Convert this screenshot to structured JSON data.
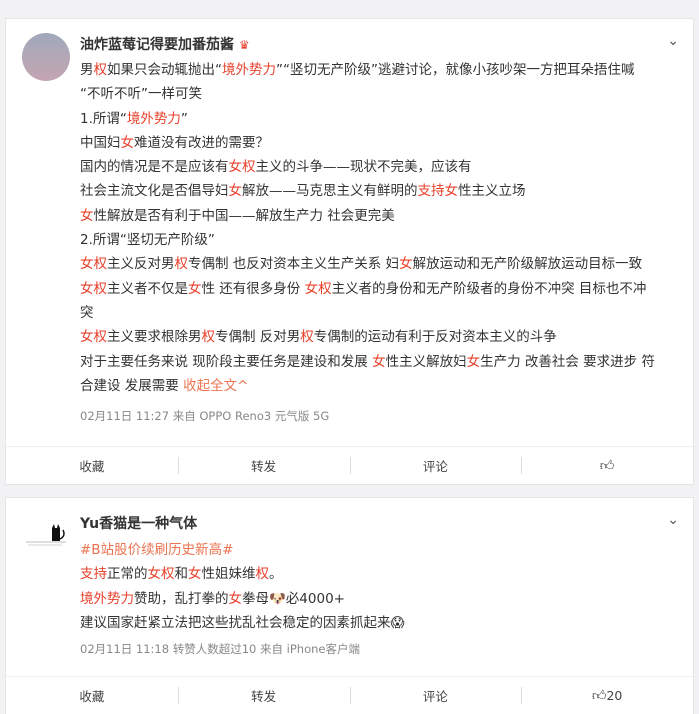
{
  "post1": {
    "username": "油炸蓝莓记得要加番茄酱",
    "badge": "♛",
    "lines": [
      [
        [
          "男",
          ""
        ],
        [
          "权",
          "r"
        ],
        [
          "如果只会动辄抛出“",
          ""
        ],
        [
          "境外势力",
          "r"
        ],
        [
          "”“竖切无产阶级”逃避讨论，就像小孩吵架一方把耳朵捂住喊",
          ""
        ]
      ],
      [
        [
          "“不听不听”一样可笑",
          ""
        ]
      ],
      [
        [
          "1.所谓“",
          ""
        ],
        [
          "境外势力",
          "r"
        ],
        [
          "”",
          ""
        ]
      ],
      [
        [
          "中国妇",
          ""
        ],
        [
          "女",
          "r"
        ],
        [
          "难道没有改进的需要？",
          ""
        ]
      ],
      [
        [
          "国内的情况是不是应该有",
          ""
        ],
        [
          "女权",
          "r"
        ],
        [
          "主义的斗争——现状不完美，应该有",
          ""
        ]
      ],
      [
        [
          "社会主流文化是否倡导妇",
          ""
        ],
        [
          "女",
          "r"
        ],
        [
          "解放——马克思主义有鲜明的",
          ""
        ],
        [
          "支持女",
          "r"
        ],
        [
          "性主义立场",
          ""
        ]
      ],
      [
        [
          "女",
          "r"
        ],
        [
          "性解放是否有利于中国——解放生产力 社会更完美",
          ""
        ]
      ],
      [
        [
          "2.所谓“竖切无产阶级”",
          ""
        ]
      ],
      [
        [
          "女权",
          "r"
        ],
        [
          "主义反对男",
          ""
        ],
        [
          "权",
          "r"
        ],
        [
          "专偶制 也反对资本主义生产关系 妇",
          ""
        ],
        [
          "女",
          "r"
        ],
        [
          "解放运动和无产阶级解放运动目标一致",
          ""
        ]
      ],
      [
        [
          "女权",
          "r"
        ],
        [
          "主义者不仅是",
          ""
        ],
        [
          "女",
          "r"
        ],
        [
          "性 还有很多身份 ",
          ""
        ],
        [
          "女权",
          "r"
        ],
        [
          "主义者的身份和无产阶级者的身份不冲突 目标也不冲",
          ""
        ]
      ],
      [
        [
          "突",
          ""
        ]
      ],
      [
        [
          "女权",
          "r"
        ],
        [
          "主义要求根除男",
          ""
        ],
        [
          "权",
          "r"
        ],
        [
          "专偶制 反对男",
          ""
        ],
        [
          "权",
          "r"
        ],
        [
          "专偶制的运动有利于反对资本主义的斗争",
          ""
        ]
      ],
      [
        [
          "对于主要任务来说 现阶段主要任务是建设和发展 ",
          ""
        ],
        [
          "女",
          "r"
        ],
        [
          "性主义解放妇",
          ""
        ],
        [
          "女",
          "r"
        ],
        [
          "生产力 改善社会 要求进步 符",
          ""
        ]
      ],
      [
        [
          "合建设 发展需要 ",
          ""
        ],
        [
          "收起全文^",
          "l"
        ]
      ]
    ],
    "meta": "02月11日 11:27  来自 OPPO Reno3 元气版 5G",
    "actions": {
      "collect": "收藏",
      "repost": "转发",
      "comment": "评论",
      "like_count": ""
    }
  },
  "post2": {
    "username": "Yu香猫是一种气体",
    "lines": [
      [
        [
          "#B站股价续刷历史新高#",
          "topic"
        ]
      ],
      [
        [
          "支持",
          "r"
        ],
        [
          "正常的",
          ""
        ],
        [
          "女权",
          "r"
        ],
        [
          "和",
          ""
        ],
        [
          "女",
          "r"
        ],
        [
          "性姐妹维",
          ""
        ],
        [
          "权",
          "r"
        ],
        [
          "。",
          ""
        ]
      ],
      [
        [
          "境外势力",
          "r"
        ],
        [
          "赞助，乱打拳的",
          ""
        ],
        [
          "女",
          "r"
        ],
        [
          "拳母🐶必4000+",
          ""
        ]
      ],
      [
        [
          "建议国家赶紧立法把这些扰乱社会稳定的因素抓起来😱",
          ""
        ]
      ]
    ],
    "meta": "02月11日 11:18 转赞人数超过10  来自 iPhone客户端",
    "actions": {
      "collect": "收藏",
      "repost": "转发",
      "comment": "评论",
      "like_count": "20"
    }
  },
  "icons": {
    "more": "chevron-down-icon",
    "like": "thumbs-up-icon"
  },
  "colors": {
    "highlight": "#e8402b",
    "link": "#eb7350"
  }
}
